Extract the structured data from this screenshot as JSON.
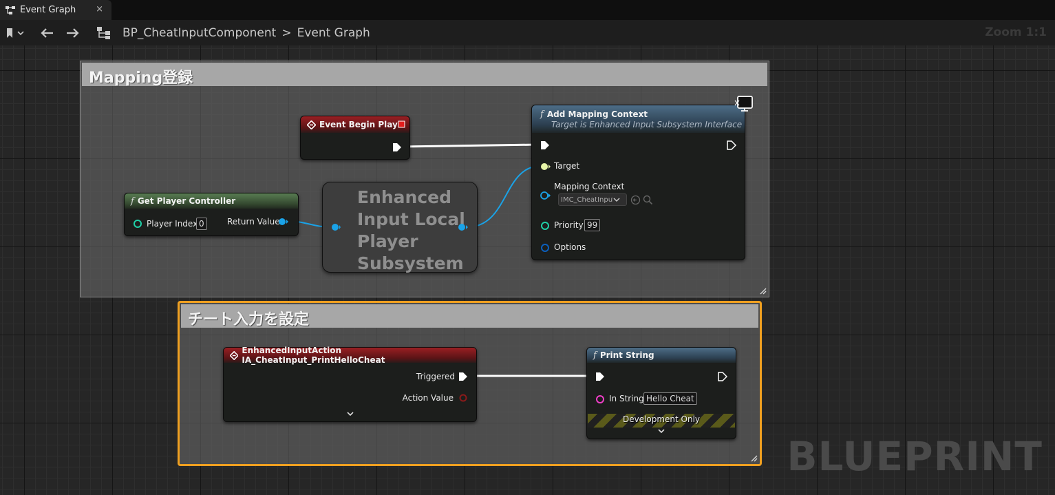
{
  "tab": {
    "label": "Event Graph",
    "close": "×"
  },
  "toolbar": {
    "breadcrumb_root": "BP_CheatInputComponent",
    "breadcrumb_sep": ">",
    "breadcrumb_current": "Event Graph",
    "zoom": "Zoom 1:1"
  },
  "watermark": "BLUEPRINT",
  "comments": {
    "mapping": {
      "title": "Mapping登録"
    },
    "cheat": {
      "title": "チート入力を設定"
    }
  },
  "nodes": {
    "begin_play": {
      "title": "Event Begin Play"
    },
    "get_player_controller": {
      "title": "Get Player Controller",
      "player_index_label": "Player Index",
      "player_index_value": "0",
      "return_label": "Return Value"
    },
    "subsystem": {
      "title": "Enhanced\nInput Local\nPlayer\nSubsystem"
    },
    "add_mapping": {
      "title": "Add Mapping Context",
      "subtitle": "Target is Enhanced Input Subsystem Interface",
      "target_label": "Target",
      "mapping_label": "Mapping Context",
      "mapping_value": "IMC_CheatInput",
      "priority_label": "Priority",
      "priority_value": "99",
      "options_label": "Options"
    },
    "input_action": {
      "title": "EnhancedInputAction IA_CheatInput_PrintHelloCheat",
      "triggered_label": "Triggered",
      "action_value_label": "Action Value"
    },
    "print_string": {
      "title": "Print String",
      "in_string_label": "In String",
      "in_string_value": "Hello Cheat",
      "dev_only": "Development Only"
    }
  },
  "colors": {
    "exec": "#ffffff",
    "object_pin": "#1aa3e8",
    "struct_pin": "#22c49b",
    "string_pin": "#f03ec8",
    "int_pin": "#1fd1a8",
    "selected_comment": "#f0a020"
  }
}
